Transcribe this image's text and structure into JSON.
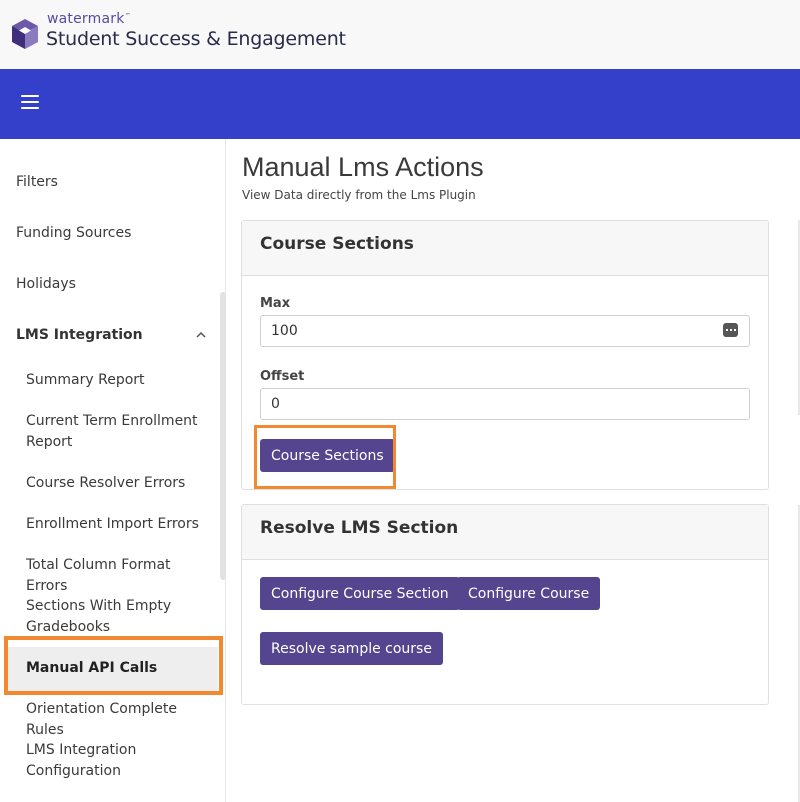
{
  "brand": {
    "small": "watermark",
    "tm": "™",
    "large": "Student Success & Engagement"
  },
  "sidebar": {
    "top_items": [
      {
        "label": "Filters"
      },
      {
        "label": "Funding Sources"
      },
      {
        "label": "Holidays"
      }
    ],
    "group": {
      "label": "LMS Integration",
      "expanded": true
    },
    "sub_items": [
      {
        "label": "Summary Report"
      },
      {
        "label": "Current Term Enrollment Report"
      },
      {
        "label": "Course Resolver Errors"
      },
      {
        "label": "Enrollment Import Errors"
      },
      {
        "label": "Total Column Format Errors"
      },
      {
        "label": "Sections With Empty Gradebooks"
      },
      {
        "label": "Manual API Calls",
        "active": true
      },
      {
        "label": "Orientation Complete Rules"
      },
      {
        "label": "LMS Integration Configuration"
      }
    ]
  },
  "main": {
    "title": "Manual Lms Actions",
    "subtitle": "View Data directly from the Lms Plugin",
    "course_sections_card": {
      "title": "Course Sections",
      "max_label": "Max",
      "max_value": "100",
      "offset_label": "Offset",
      "offset_value": "0",
      "button": "Course Sections"
    },
    "resolve_card": {
      "title": "Resolve LMS Section",
      "buttons": [
        "Configure Course Section",
        "Configure Course",
        "Resolve sample course"
      ]
    }
  },
  "colors": {
    "navbar": "#3440c9",
    "button": "#55458f",
    "highlight": "#f0892f",
    "brand": "#5a4a9e"
  }
}
